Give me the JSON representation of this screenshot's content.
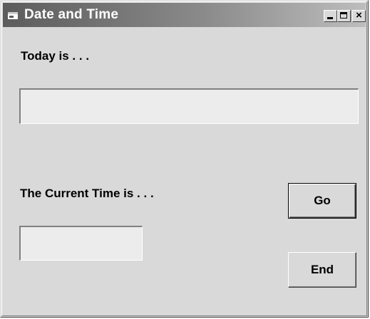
{
  "window": {
    "title": "Date and Time",
    "controls": {
      "minimize": "minimize",
      "maximize": "maximize",
      "close": "×"
    }
  },
  "form": {
    "today_label": "Today is . . .",
    "date_value": "",
    "time_label": "The Current Time is . . .",
    "time_value": "",
    "go_label": "Go",
    "end_label": "End"
  },
  "icons": {
    "app": "app-window-icon",
    "minimize": "minimize-icon",
    "maximize": "maximize-icon",
    "close": "close-icon"
  },
  "colors": {
    "face": "#d9d9d9",
    "titlebar_start": "#5c5c5c",
    "titlebar_end": "#bdbdbd",
    "textbox": "#ececec"
  }
}
